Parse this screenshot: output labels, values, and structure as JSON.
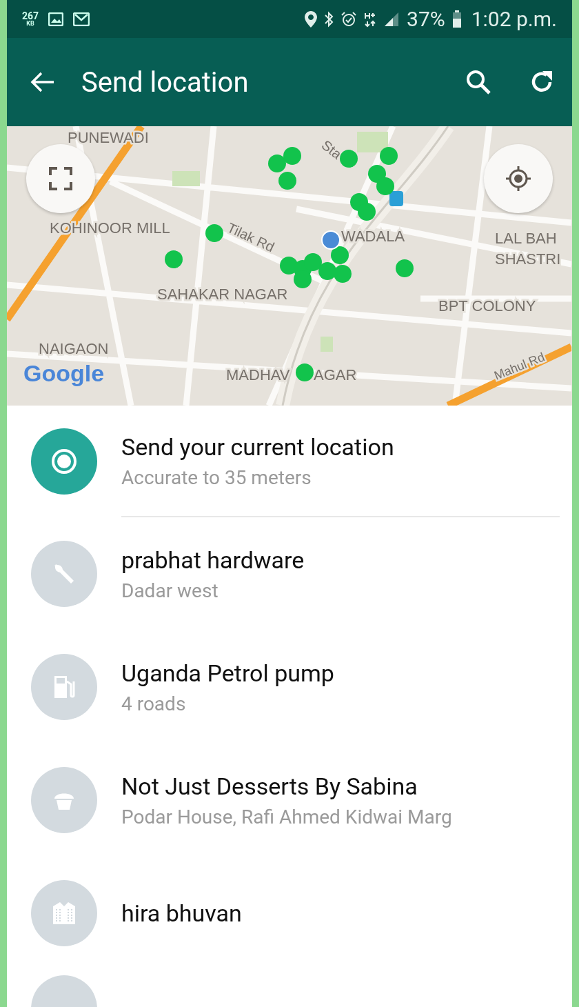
{
  "status_bar": {
    "data_speed": "267",
    "data_unit": "KB",
    "battery": "37%",
    "time": "1:02 p.m."
  },
  "toolbar": {
    "title": "Send location"
  },
  "map": {
    "labels": [
      "PUNEWADI",
      "KOHINOOR MILL",
      "Tilak Rd",
      "WADALA",
      "LAL BAH",
      "SHASTRI",
      "SAHAKAR NAGAR",
      "BPT COLONY",
      "NAIGAON",
      "MADHAV",
      "AGAR",
      "Mahul Rd",
      "Sta"
    ],
    "logo": "Google"
  },
  "places": [
    {
      "kind": "current",
      "title": "Send your current location",
      "subtitle": "Accurate to 35 meters"
    },
    {
      "kind": "hardware",
      "title": "prabhat hardware",
      "subtitle": "Dadar west"
    },
    {
      "kind": "fuel",
      "title": "Uganda Petrol pump",
      "subtitle": "4 roads"
    },
    {
      "kind": "bakery",
      "title": "Not Just Desserts By Sabina",
      "subtitle": "Podar House, Rafi Ahmed Kidwai Marg"
    },
    {
      "kind": "building",
      "title": "hira bhuvan"
    },
    {
      "kind": "partial"
    }
  ]
}
